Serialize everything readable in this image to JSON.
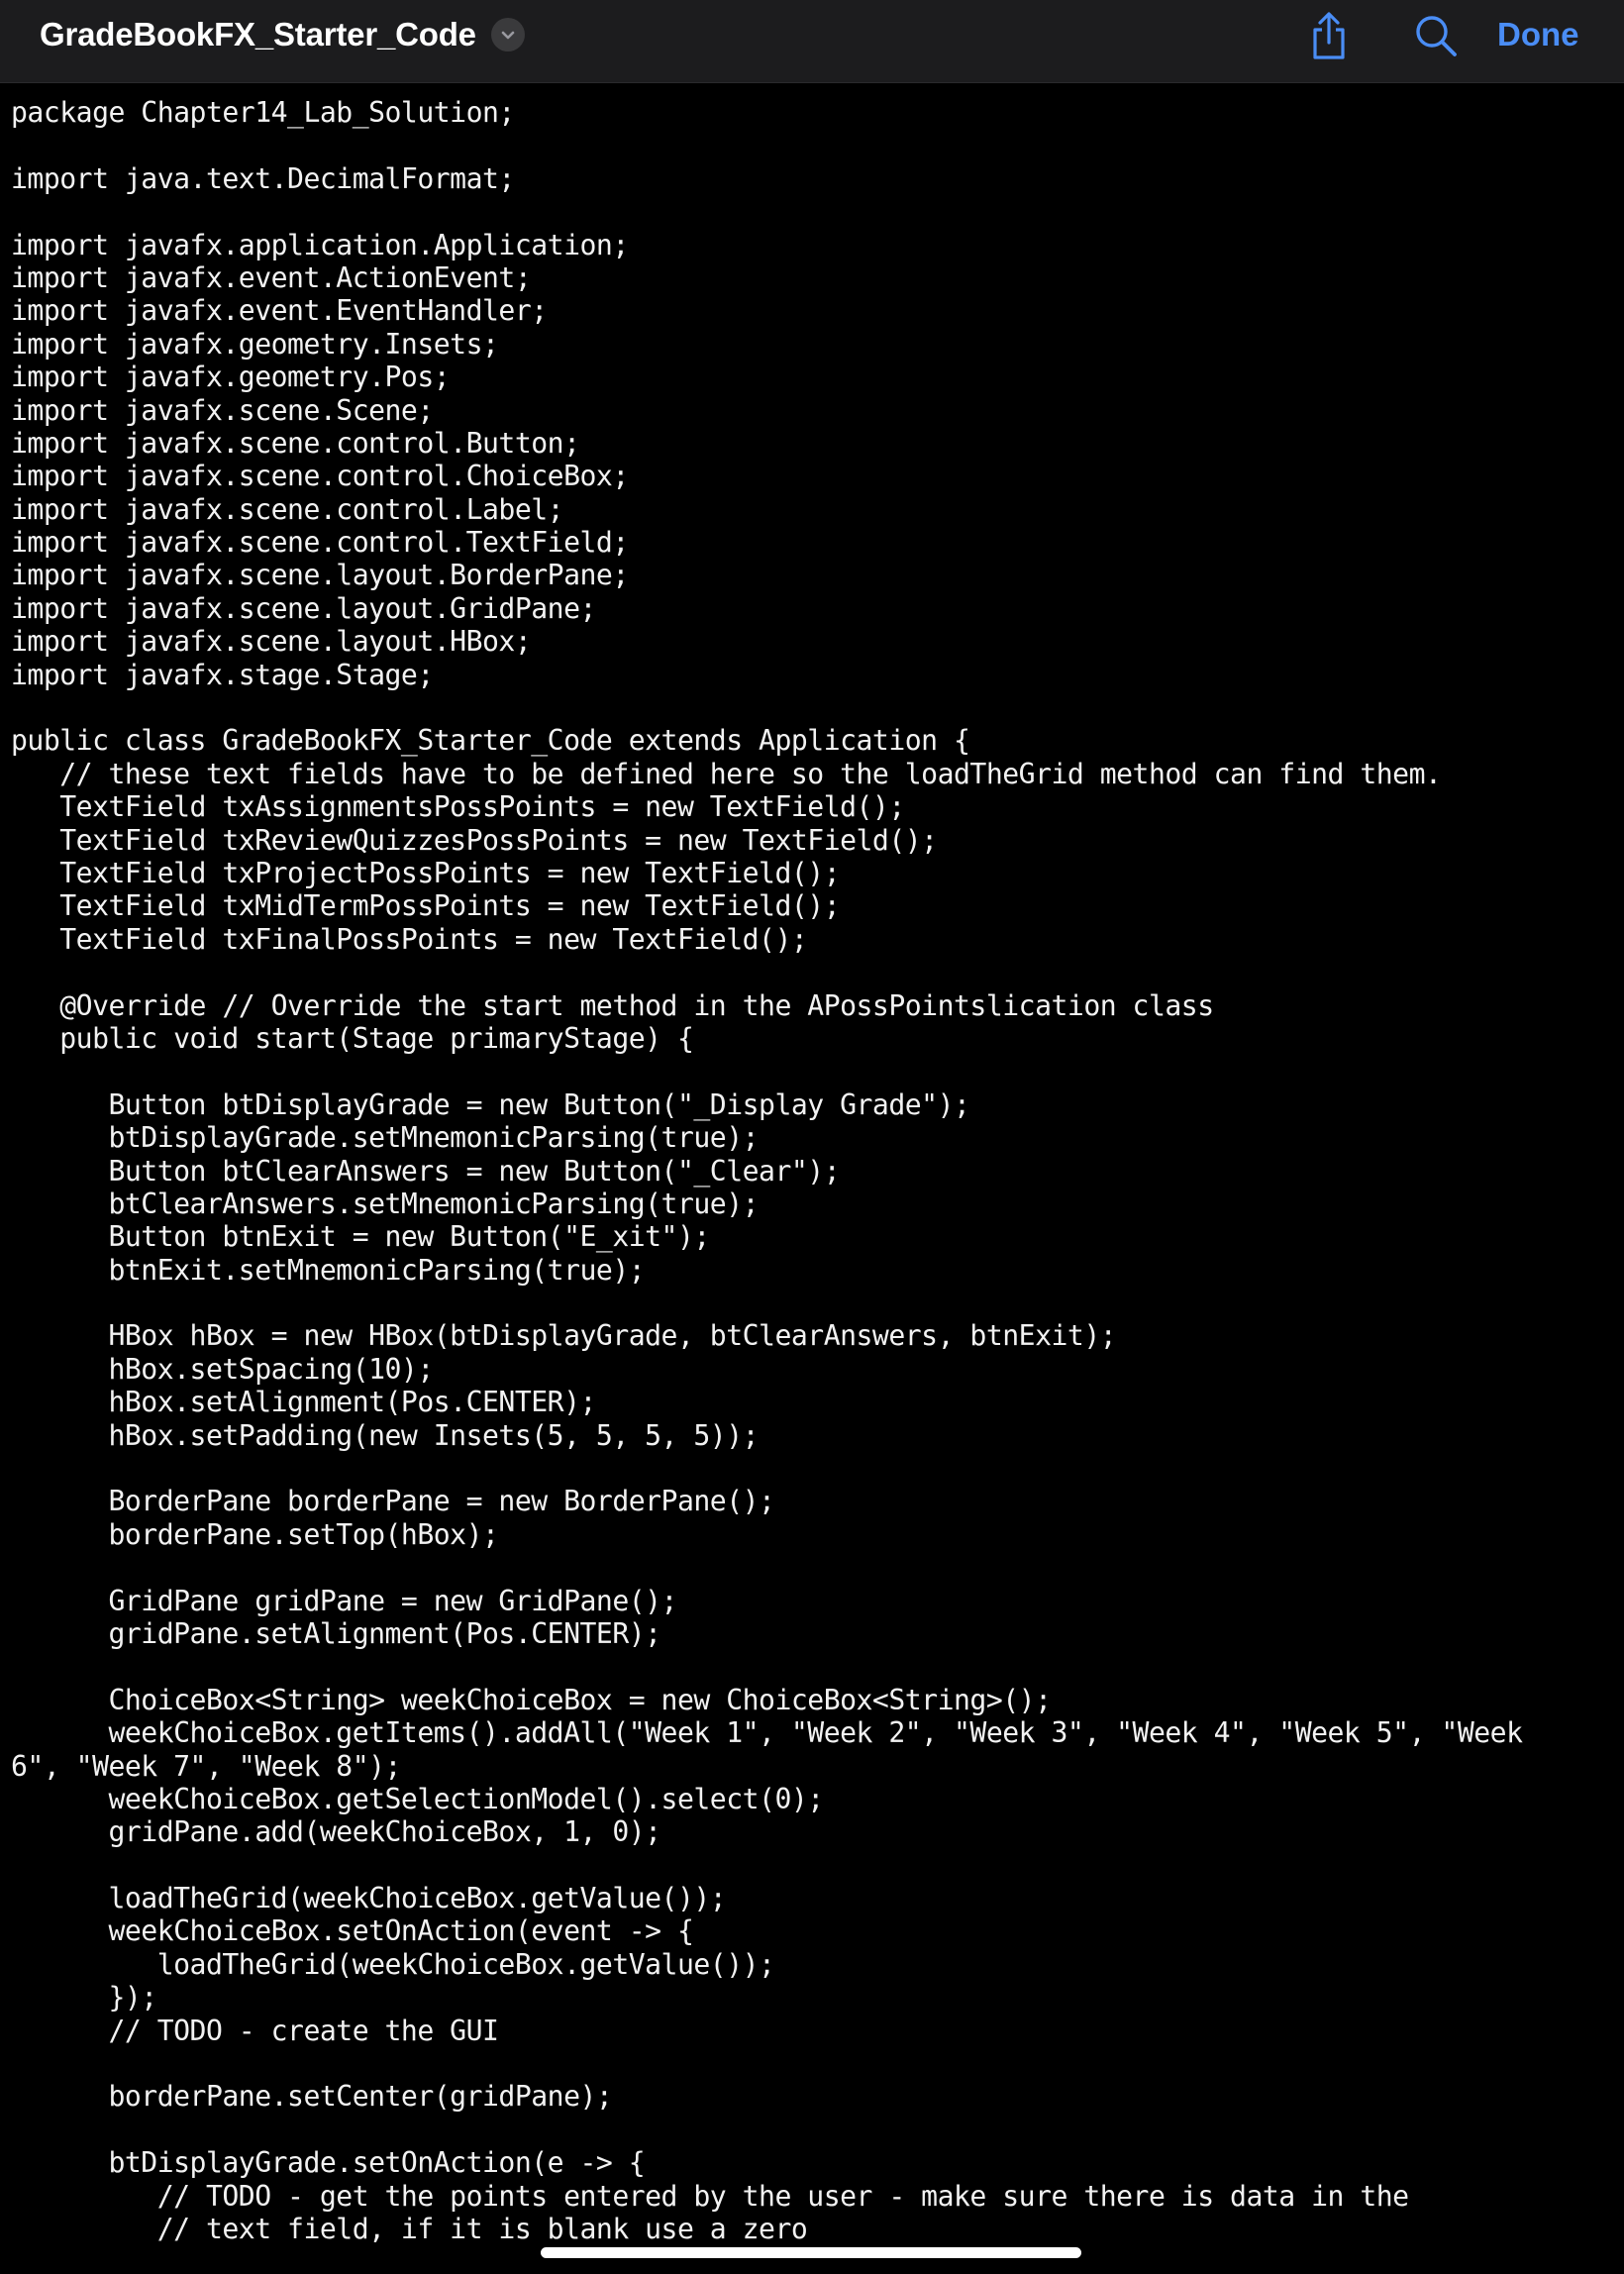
{
  "header": {
    "title": "GradeBookFX_Starter_Code",
    "done_label": "Done",
    "icons": {
      "title_menu": "chevron-down-icon",
      "share": "share-icon",
      "search": "search-icon"
    }
  },
  "colors": {
    "background": "#000000",
    "nav_background": "#1c1c1e",
    "accent": "#4a8df5",
    "text": "#f2f2f2"
  },
  "code_lines": [
    "package Chapter14_Lab_Solution;",
    "",
    "import java.text.DecimalFormat;",
    "",
    "import javafx.application.Application;",
    "import javafx.event.ActionEvent;",
    "import javafx.event.EventHandler;",
    "import javafx.geometry.Insets;",
    "import javafx.geometry.Pos;",
    "import javafx.scene.Scene;",
    "import javafx.scene.control.Button;",
    "import javafx.scene.control.ChoiceBox;",
    "import javafx.scene.control.Label;",
    "import javafx.scene.control.TextField;",
    "import javafx.scene.layout.BorderPane;",
    "import javafx.scene.layout.GridPane;",
    "import javafx.scene.layout.HBox;",
    "import javafx.stage.Stage;",
    "",
    "public class GradeBookFX_Starter_Code extends Application {",
    "   // these text fields have to be defined here so the loadTheGrid method can find them.",
    "   TextField txAssignmentsPossPoints = new TextField();",
    "   TextField txReviewQuizzesPossPoints = new TextField();",
    "   TextField txProjectPossPoints = new TextField();",
    "   TextField txMidTermPossPoints = new TextField();",
    "   TextField txFinalPossPoints = new TextField();",
    "",
    "   @Override // Override the start method in the APossPointslication class",
    "   public void start(Stage primaryStage) {",
    "",
    "      Button btDisplayGrade = new Button(\"_Display Grade\");",
    "      btDisplayGrade.setMnemonicParsing(true);",
    "      Button btClearAnswers = new Button(\"_Clear\");",
    "      btClearAnswers.setMnemonicParsing(true);",
    "      Button btnExit = new Button(\"E_xit\");",
    "      btnExit.setMnemonicParsing(true);",
    "",
    "      HBox hBox = new HBox(btDisplayGrade, btClearAnswers, btnExit);",
    "      hBox.setSpacing(10);",
    "      hBox.setAlignment(Pos.CENTER);",
    "      hBox.setPadding(new Insets(5, 5, 5, 5));",
    "",
    "      BorderPane borderPane = new BorderPane();",
    "      borderPane.setTop(hBox);",
    "",
    "      GridPane gridPane = new GridPane();",
    "      gridPane.setAlignment(Pos.CENTER);",
    "",
    "      ChoiceBox<String> weekChoiceBox = new ChoiceBox<String>();",
    "      weekChoiceBox.getItems().addAll(\"Week 1\", \"Week 2\", \"Week 3\", \"Week 4\", \"Week 5\", \"Week",
    "6\", \"Week 7\", \"Week 8\");",
    "      weekChoiceBox.getSelectionModel().select(0);",
    "      gridPane.add(weekChoiceBox, 1, 0);",
    "",
    "      loadTheGrid(weekChoiceBox.getValue());",
    "      weekChoiceBox.setOnAction(event -> {",
    "         loadTheGrid(weekChoiceBox.getValue());",
    "      });",
    "      // TODO - create the GUI",
    "",
    "      borderPane.setCenter(gridPane);",
    "",
    "      btDisplayGrade.setOnAction(e -> {",
    "         // TODO - get the points entered by the user - make sure there is data in the",
    "         // text field, if it is blank use a zero"
  ]
}
